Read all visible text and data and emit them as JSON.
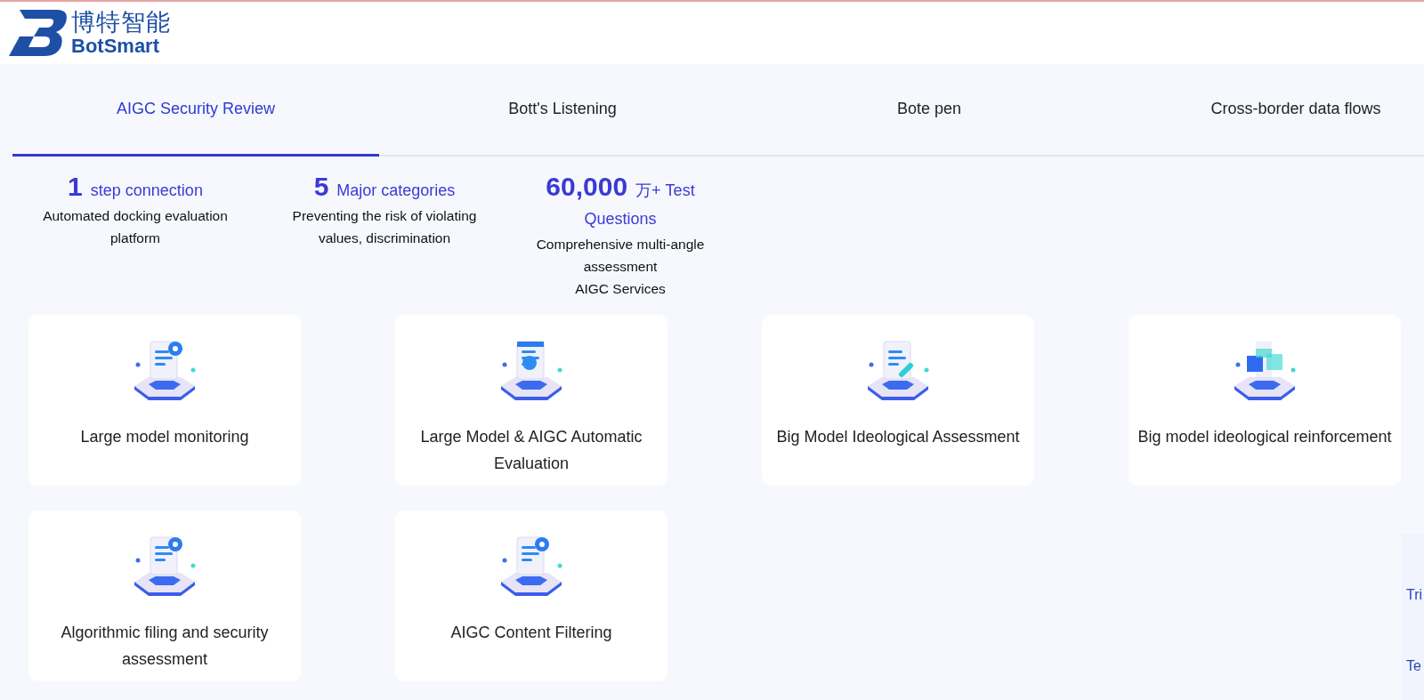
{
  "logo": {
    "name_cn": "博特智能",
    "name_en": "BotSmart"
  },
  "tabs": [
    {
      "label": "AIGC Security Review",
      "selected": true
    },
    {
      "label": "Bott's Listening",
      "selected": false
    },
    {
      "label": "Bote pen",
      "selected": false
    },
    {
      "label": "Cross-border data flows",
      "selected": false
    }
  ],
  "stats": [
    {
      "number": "1",
      "unit": "step connection",
      "lines": [
        "Automated docking evaluation platform"
      ]
    },
    {
      "number": "5",
      "unit": "Major categories",
      "lines": [
        "Preventing   the risk of violating values, discrimination"
      ]
    },
    {
      "number": "60,000",
      "unit": "万+ Test Questions",
      "lines": [
        "Comprehensive multi-angle assessment",
        "AIGC Services"
      ]
    }
  ],
  "cards": [
    {
      "title": "Large model monitoring",
      "kind": "magnifier"
    },
    {
      "title": "Large Model & AIGC Automatic Evaluation",
      "kind": "clock"
    },
    {
      "title": "Big Model Ideological Assessment",
      "kind": "pen"
    },
    {
      "title": "Big model ideological reinforcement",
      "kind": "cubes"
    },
    {
      "title": "Algorithmic filing and security assessment",
      "kind": "magnifier"
    },
    {
      "title": "AIGC Content Filtering",
      "kind": "magnifier"
    }
  ],
  "side_card": {
    "lines": [
      "Tri",
      "Te"
    ]
  }
}
